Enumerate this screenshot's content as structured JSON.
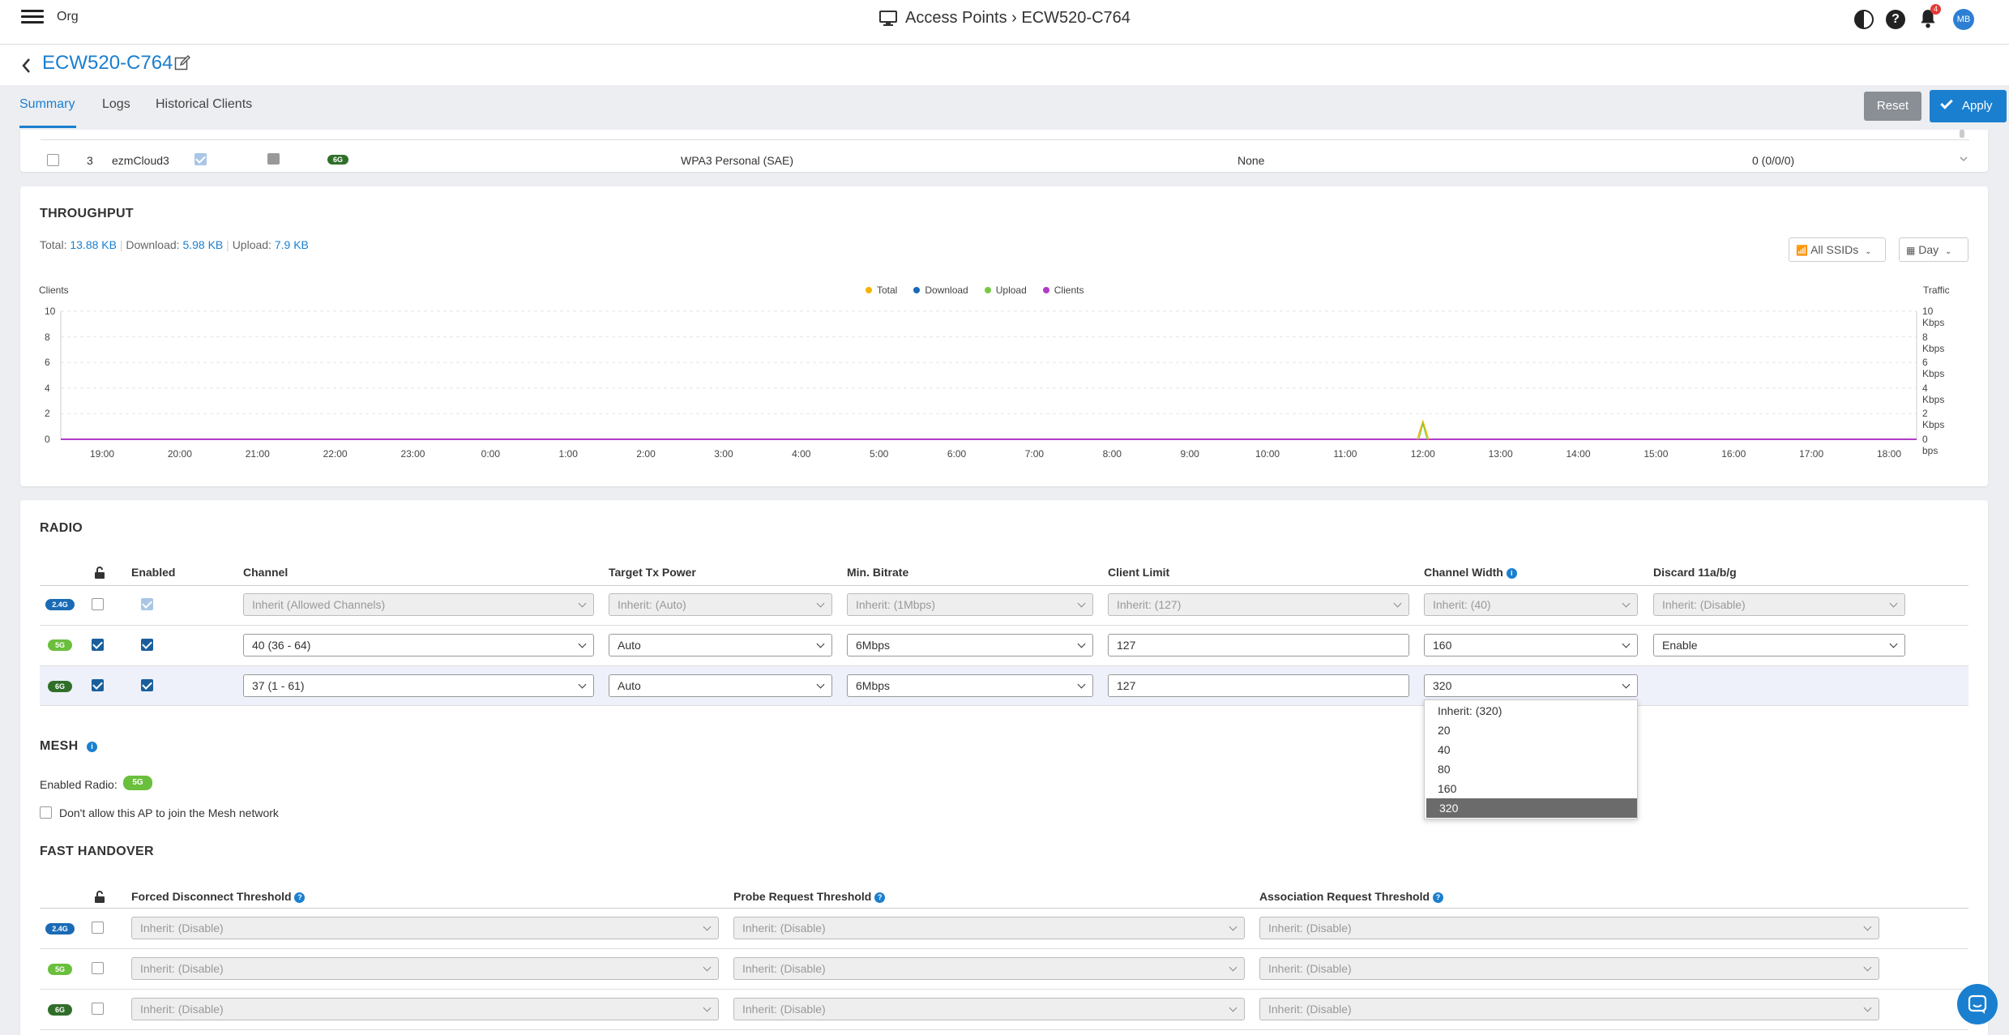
{
  "topbar": {
    "org": "Org",
    "breadcrumb": "Access Points › ECW520-C764",
    "notification_count": "4",
    "avatar_initials": "MB"
  },
  "device": {
    "name": "ECW520-C764"
  },
  "tabs": [
    {
      "label": "Summary",
      "active": true
    },
    {
      "label": "Logs"
    },
    {
      "label": "Historical Clients"
    }
  ],
  "actions": {
    "reset": "Reset",
    "apply": "Apply"
  },
  "ssid_row": {
    "index": "3",
    "name": "ezmCloud3",
    "band": "6G",
    "security": "WPA3 Personal (SAE)",
    "vlan": "None",
    "clients": "0 (0/0/0)"
  },
  "throughput": {
    "title": "THROUGHPUT",
    "total_label": "Total:",
    "total_value": "13.88 KB",
    "download_label": "Download:",
    "download_value": "5.98 KB",
    "upload_label": "Upload:",
    "upload_value": "7.9 KB",
    "ssid_filter": "All SSIDs",
    "period": "Day"
  },
  "chart_data": {
    "type": "line",
    "ylabel_left": "Clients",
    "ylabel_right": "Traffic",
    "y_left_ticks": [
      "10",
      "8",
      "6",
      "4",
      "2",
      "0"
    ],
    "y_right_ticks": [
      "10 Kbps",
      "8 Kbps",
      "6 Kbps",
      "4 Kbps",
      "2 Kbps",
      "0 bps"
    ],
    "x": [
      "19:00",
      "20:00",
      "21:00",
      "22:00",
      "23:00",
      "0:00",
      "1:00",
      "2:00",
      "3:00",
      "4:00",
      "5:00",
      "6:00",
      "7:00",
      "8:00",
      "9:00",
      "10:00",
      "11:00",
      "12:00",
      "13:00",
      "14:00",
      "15:00",
      "16:00",
      "17:00",
      "18:00"
    ],
    "legend": [
      "Total",
      "Download",
      "Upload",
      "Clients"
    ],
    "colors": {
      "Total": "#f5b400",
      "Download": "#1a6bb5",
      "Upload": "#7ac943",
      "Clients": "#b23cc8"
    },
    "ylim_left": [
      0,
      10
    ],
    "ylim_right_kbps": [
      0,
      10
    ],
    "series": [
      {
        "name": "Clients",
        "values": [
          0,
          0,
          0,
          0,
          0,
          0,
          0,
          0,
          0,
          0,
          0,
          0,
          0,
          0,
          0,
          0,
          0,
          0,
          0,
          0,
          0,
          0,
          0,
          0
        ]
      },
      {
        "name": "Total",
        "peak_at": "12:00",
        "peak_kbps": 0.4
      }
    ]
  },
  "radio": {
    "title": "RADIO",
    "headers": {
      "enabled": "Enabled",
      "channel": "Channel",
      "tx_power": "Target Tx Power",
      "min_bitrate": "Min. Bitrate",
      "client_limit": "Client Limit",
      "channel_width": "Channel Width",
      "discard": "Discard 11a/b/g"
    },
    "rows": [
      {
        "band": "2.4G",
        "channel": "Inherit (Allowed Channels)",
        "tx": "Inherit: (Auto)",
        "bitrate": "Inherit: (1Mbps)",
        "limit": "Inherit: (127)",
        "width": "Inherit: (40)",
        "discard": "Inherit: (Disable)"
      },
      {
        "band": "5G",
        "channel": "40 (36 - 64)",
        "tx": "Auto",
        "bitrate": "6Mbps",
        "limit": "127",
        "width": "160",
        "discard": "Enable"
      },
      {
        "band": "6G",
        "channel": "37 (1 - 61)",
        "tx": "Auto",
        "bitrate": "6Mbps",
        "limit": "127",
        "width": "320"
      }
    ],
    "width_options": [
      "Inherit: (320)",
      "20",
      "40",
      "80",
      "160",
      "320"
    ]
  },
  "mesh": {
    "title": "MESH",
    "enabled_radio_label": "Enabled Radio:",
    "enabled_radio": "5G",
    "dont_allow": "Don't allow this AP to join the Mesh network"
  },
  "fast_handover": {
    "title": "FAST HANDOVER",
    "headers": {
      "forced": "Forced Disconnect Threshold",
      "probe": "Probe Request Threshold",
      "assoc": "Association Request Threshold"
    },
    "rows": [
      {
        "band": "2.4G",
        "value": "Inherit: (Disable)"
      },
      {
        "band": "5G",
        "value": "Inherit: (Disable)"
      },
      {
        "band": "6G",
        "value": "Inherit: (Disable)"
      }
    ]
  }
}
